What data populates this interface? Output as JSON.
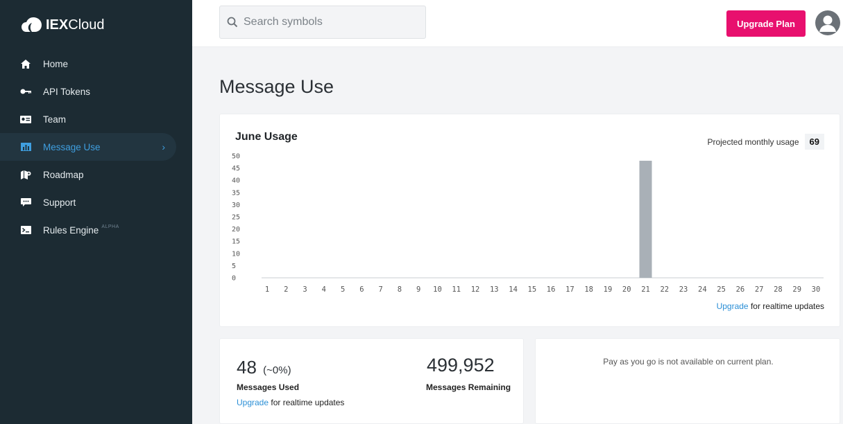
{
  "brand": {
    "name_bold": "IEX",
    "name_rest": "Cloud"
  },
  "sidebar": {
    "items": [
      {
        "label": "Home",
        "icon": "home-icon"
      },
      {
        "label": "API Tokens",
        "icon": "key-icon"
      },
      {
        "label": "Team",
        "icon": "id-card-icon"
      },
      {
        "label": "Message Use",
        "icon": "bar-chart-icon",
        "active": true
      },
      {
        "label": "Roadmap",
        "icon": "map-icon"
      },
      {
        "label": "Support",
        "icon": "chat-icon"
      },
      {
        "label": "Rules Engine",
        "icon": "terminal-icon",
        "badge": "ALPHA"
      }
    ]
  },
  "topbar": {
    "search_placeholder": "Search symbols",
    "upgrade_label": "Upgrade Plan"
  },
  "main": {
    "title": "Message Use",
    "chart_card": {
      "title": "June Usage",
      "projected_label": "Projected monthly usage",
      "projected_value": "69",
      "footer_link": "Upgrade",
      "footer_text": " for realtime updates"
    },
    "stats": {
      "used_value": "48",
      "used_pct": "(~0%)",
      "used_label": "Messages Used",
      "footer_link": "Upgrade",
      "footer_text": " for realtime updates",
      "remaining_value": "499,952",
      "remaining_label": "Messages Remaining"
    },
    "payg_text": "Pay as you go is not available on current plan."
  },
  "colors": {
    "sidebar_bg": "#1c2b33",
    "accent_pink": "#e8106e",
    "active_blue": "#3f9fe0",
    "bar_gray": "#a9b0b7"
  },
  "chart_data": {
    "type": "bar",
    "categories": [
      "1",
      "2",
      "3",
      "4",
      "5",
      "6",
      "7",
      "8",
      "9",
      "10",
      "11",
      "12",
      "13",
      "14",
      "15",
      "16",
      "17",
      "18",
      "19",
      "20",
      "21",
      "22",
      "23",
      "24",
      "25",
      "26",
      "27",
      "28",
      "29",
      "30"
    ],
    "values": [
      0,
      0,
      0,
      0,
      0,
      0,
      0,
      0,
      0,
      0,
      0,
      0,
      0,
      0,
      0,
      0,
      0,
      0,
      0,
      0,
      48,
      0,
      0,
      0,
      0,
      0,
      0,
      0,
      0,
      0
    ],
    "y_ticks": [
      "0",
      "5",
      "10",
      "15",
      "20",
      "25",
      "30",
      "35",
      "40",
      "45",
      "50"
    ],
    "ylim": [
      0,
      50
    ],
    "title": "June Usage",
    "xlabel": "",
    "ylabel": "",
    "grid": false
  }
}
